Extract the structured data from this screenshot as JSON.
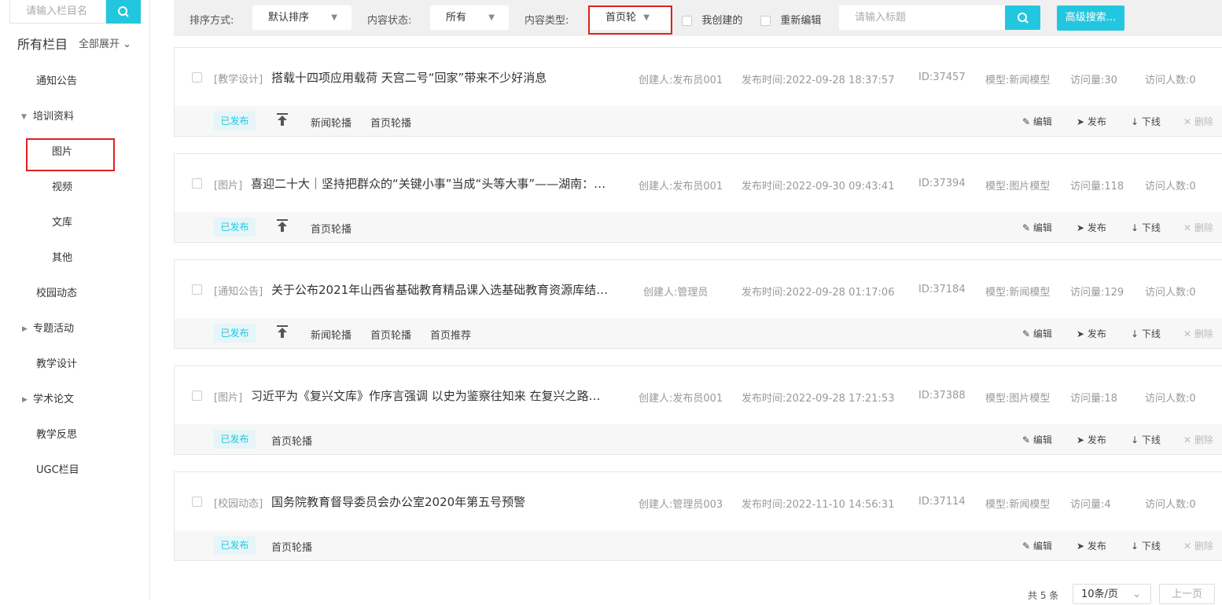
{
  "sidebar": {
    "search_placeholder": "请输入栏目名",
    "title": "所有栏目",
    "expand_all": "全部展开",
    "items": [
      {
        "label": "通知公告"
      },
      {
        "label": "培训资料"
      },
      {
        "label": "图片"
      },
      {
        "label": "视频"
      },
      {
        "label": "文库"
      },
      {
        "label": "其他"
      },
      {
        "label": "校园动态"
      },
      {
        "label": "专题活动"
      },
      {
        "label": "教学设计"
      },
      {
        "label": "学术论文"
      },
      {
        "label": "教学反思"
      },
      {
        "label": "UGC栏目"
      }
    ]
  },
  "toolbar": {
    "sort_label": "排序方式:",
    "sort_value": "默认排序",
    "status_label": "内容状态:",
    "status_value": "所有",
    "type_label": "内容类型:",
    "type_value": "首页轮",
    "my_created": "我创建的",
    "re_edit": "重新编辑",
    "search_placeholder": "请输入标题",
    "advanced": "高级搜索..."
  },
  "labels": {
    "creator": "创建人:",
    "time": "发布时间:",
    "id": "ID:",
    "model": "模型:",
    "visits": "访问量:",
    "visitors": "访问人数:",
    "edit": "编辑",
    "publish": "发布",
    "offline": "下线",
    "delete": "删除"
  },
  "items": [
    {
      "category": "[教学设计]",
      "title": "搭载十四项应用载荷 天宫二号“回家”带来不少好消息",
      "creator": "发布员001",
      "time": "2022-09-28 18:37:57",
      "id": "37457",
      "model": "新闻模型",
      "visits": "30",
      "visitors": "0",
      "status": "已发布",
      "tags": [
        "新闻轮播",
        "首页轮播"
      ]
    },
    {
      "category": "[图片]",
      "title": "喜迎二十大｜坚持把群众的“关键小事”当成“头等大事”——湖南：…",
      "creator": "发布员001",
      "time": "2022-09-30 09:43:41",
      "id": "37394",
      "model": "图片模型",
      "visits": "118",
      "visitors": "0",
      "status": "已发布",
      "tags": [
        "首页轮播"
      ]
    },
    {
      "category": "[通知公告]",
      "title": "关于公布2021年山西省基础教育精品课入选基础教育资源库结…",
      "creator": "管理员",
      "time": "2022-09-28 01:17:06",
      "id": "37184",
      "model": "新闻模型",
      "visits": "129",
      "visitors": "0",
      "status": "已发布",
      "tags": [
        "新闻轮播",
        "首页轮播",
        "首页推荐"
      ]
    },
    {
      "category": "[图片]",
      "title": "习近平为《复兴文库》作序言强调 以史为鉴察往知来 在复兴之路…",
      "creator": "发布员001",
      "time": "2022-09-28 17:21:53",
      "id": "37388",
      "model": "图片模型",
      "visits": "18",
      "visitors": "0",
      "status": "已发布",
      "tags": [
        "首页轮播"
      ]
    },
    {
      "category": "[校园动态]",
      "title": "国务院教育督导委员会办公室2020年第五号预警",
      "creator": "管理员003",
      "time": "2022-11-10 14:56:31",
      "id": "37114",
      "model": "新闻模型",
      "visits": "4",
      "visitors": "0",
      "status": "已发布",
      "tags": [
        "首页轮播"
      ]
    }
  ],
  "pagination": {
    "total": "共 5 条",
    "page_size": "10条/页",
    "prev": "上一页"
  }
}
